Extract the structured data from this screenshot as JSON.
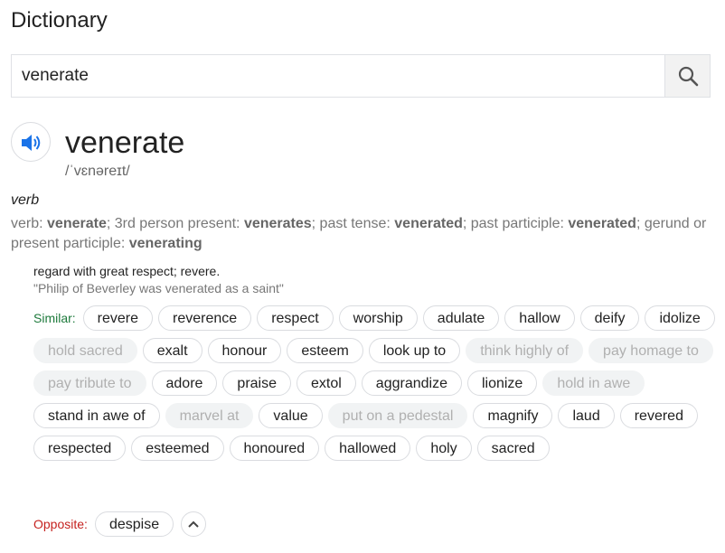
{
  "title": "Dictionary",
  "search": {
    "value": "venerate",
    "button_icon": "search-icon"
  },
  "entry": {
    "speaker_icon": "speaker-icon",
    "word": "venerate",
    "phonetic": "/ˈvɛnəreɪt/",
    "part_of_speech": "verb",
    "forms": {
      "prefix": "verb: ",
      "base": "venerate",
      "l1": "; 3rd person present: ",
      "third": "venerates",
      "l2": "; past tense: ",
      "past": "venerated",
      "l3": "; past participle: ",
      "pp": "venerated",
      "l4": "; gerund or present participle: ",
      "ger": "venerating"
    },
    "definition": "regard with great respect; revere.",
    "example": "\"Philip of Beverley was venerated as a saint\"",
    "similar_label": "Similar:",
    "similar": [
      {
        "text": "revere",
        "muted": false
      },
      {
        "text": "reverence",
        "muted": false
      },
      {
        "text": "respect",
        "muted": false
      },
      {
        "text": "worship",
        "muted": false
      },
      {
        "text": "adulate",
        "muted": false
      },
      {
        "text": "hallow",
        "muted": false
      },
      {
        "text": "deify",
        "muted": false
      },
      {
        "text": "idolize",
        "muted": false
      },
      {
        "text": "hold sacred",
        "muted": true
      },
      {
        "text": "exalt",
        "muted": false
      },
      {
        "text": "honour",
        "muted": false
      },
      {
        "text": "esteem",
        "muted": false
      },
      {
        "text": "look up to",
        "muted": false
      },
      {
        "text": "think highly of",
        "muted": true
      },
      {
        "text": "pay homage to",
        "muted": true
      },
      {
        "text": "pay tribute to",
        "muted": true
      },
      {
        "text": "adore",
        "muted": false
      },
      {
        "text": "praise",
        "muted": false
      },
      {
        "text": "extol",
        "muted": false
      },
      {
        "text": "aggrandize",
        "muted": false
      },
      {
        "text": "lionize",
        "muted": false
      },
      {
        "text": "hold in awe",
        "muted": true
      },
      {
        "text": "stand in awe of",
        "muted": false
      },
      {
        "text": "marvel at",
        "muted": true
      },
      {
        "text": "value",
        "muted": false
      },
      {
        "text": "put on a pedestal",
        "muted": true
      },
      {
        "text": "magnify",
        "muted": false
      },
      {
        "text": "laud",
        "muted": false
      },
      {
        "text": "revered",
        "muted": false
      },
      {
        "text": "respected",
        "muted": false
      },
      {
        "text": "esteemed",
        "muted": false
      },
      {
        "text": "honoured",
        "muted": false
      },
      {
        "text": "hallowed",
        "muted": false
      },
      {
        "text": "holy",
        "muted": false
      },
      {
        "text": "sacred",
        "muted": false
      }
    ],
    "opposite_label": "Opposite:",
    "opposite": [
      "despise"
    ],
    "collapse_icon": "chevron-up-icon"
  },
  "colors": {
    "similar_label": "#1e7a3c",
    "opposite_label": "#c5221f",
    "speaker": "#1a73e8"
  }
}
